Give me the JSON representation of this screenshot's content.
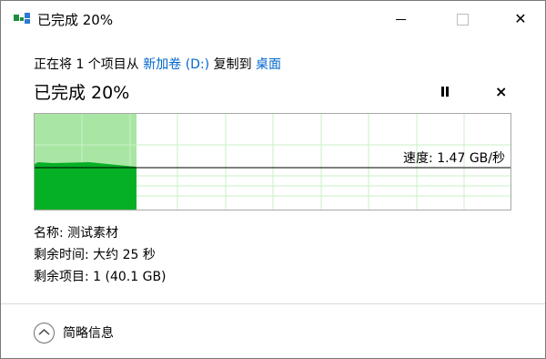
{
  "titlebar": {
    "title": "已完成 20%",
    "icon": "file-copy-icon",
    "minimize_icon": "minimize-icon",
    "maximize_icon": "maximize-icon",
    "close_glyph": "✕"
  },
  "operation": {
    "prefix": "正在将 1 个项目从",
    "source": "新加卷 (D:)",
    "middle": "复制到",
    "destination": "桌面",
    "link_color": "#0066cc"
  },
  "status": {
    "title": "已完成 20%",
    "progress": 0.2,
    "pause_icon": "pause-icon",
    "stop_glyph": "×"
  },
  "graph": {
    "speed_label": "速度: 1.47 GB/秒",
    "fill_color": "#06b025",
    "light_fill_color": "#a9e6a4",
    "grid_color": "#c9f2c4"
  },
  "details": {
    "name": "名称: 测试素材",
    "time_remaining": "剩余时间: 大约 25 秒",
    "items_remaining": "剩余项目: 1 (40.1 GB)"
  },
  "footer": {
    "toggle_icon": "chevron-up-icon",
    "label": "简略信息"
  }
}
